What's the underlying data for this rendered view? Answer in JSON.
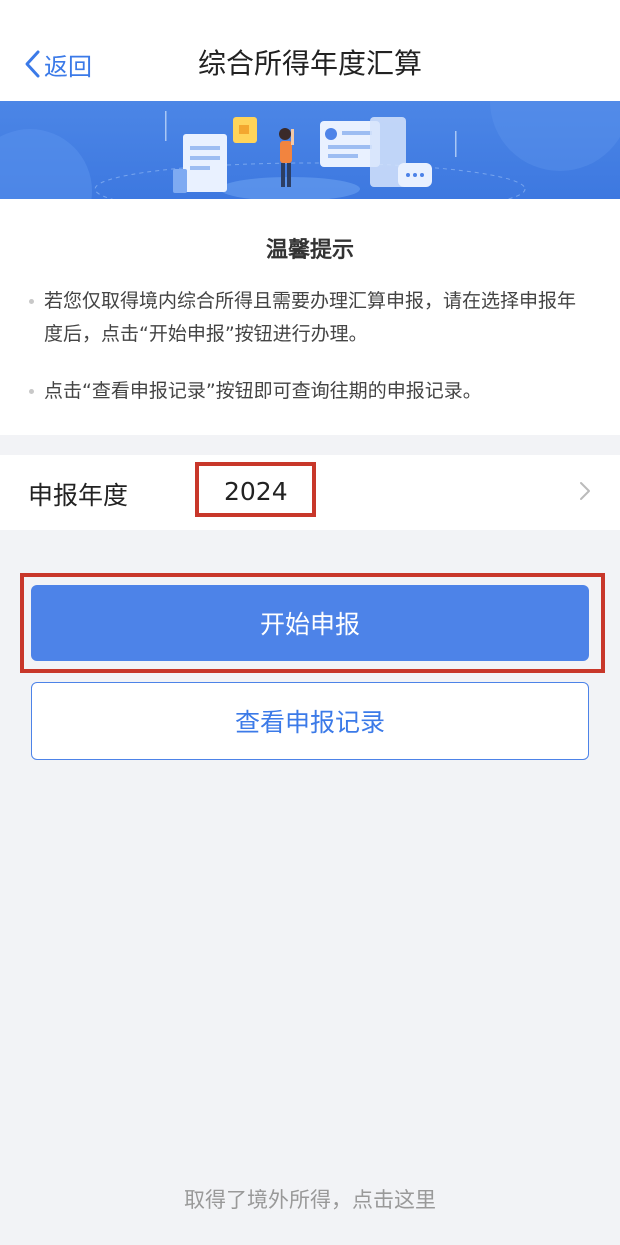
{
  "nav": {
    "back_label": "返回",
    "title": "综合所得年度汇算"
  },
  "notice": {
    "title": "温馨提示",
    "tips": [
      "若您仅取得境内综合所得且需要办理汇算申报，请在选择申报年度后，点击“开始申报”按钮进行办理。",
      "点击“查看申报记录”按钮即可查询往期的申报记录。"
    ]
  },
  "year_row": {
    "label": "申报年度",
    "value": "2024"
  },
  "buttons": {
    "start": "开始申报",
    "records": "查看申报记录"
  },
  "footer": {
    "link": "取得了境外所得，点击这里"
  },
  "colors": {
    "accent": "#4d83e8",
    "banner": "#3d78e0",
    "highlight_border": "#c8372a"
  }
}
